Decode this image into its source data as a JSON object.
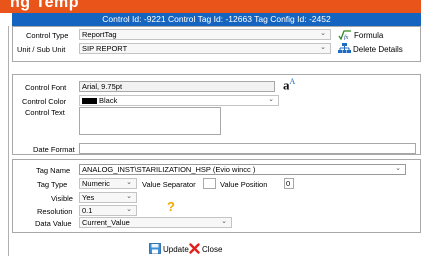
{
  "header": {
    "brand": "ng Temp",
    "title": "Control Id: -9221 Control Tag Id: -12663 Tag Config Id: -2452"
  },
  "control": {
    "type_label": "Control Type",
    "type_value": "ReportTag",
    "unit_label": "Unit / Sub Unit",
    "unit_value": "SIP REPORT",
    "formula_label": "Formula",
    "delete_label": "Delete Details"
  },
  "appearance": {
    "font_label": "Control Font",
    "font_value": "Arial, 9.75pt",
    "color_label": "Control Color",
    "color_value": "Black",
    "text_label": "Control Text",
    "text_value": "",
    "date_format_label": "Date Format",
    "date_format_value": ""
  },
  "tag": {
    "name_label": "Tag Name",
    "name_value": "ANALOG_INST\\STARILIZATION_HSP (Evio wincc )",
    "type_label": "Tag Type",
    "type_value": "Numeric",
    "separator_label": "Value Separator",
    "position_label": "Value Position",
    "position_value": "0",
    "visible_label": "Visible",
    "visible_value": "Yes",
    "resolution_label": "Resolution",
    "resolution_value": "0.1",
    "data_value_label": "Data Value",
    "data_value_value": "Current_Value"
  },
  "actions": {
    "update_label": "Update",
    "close_label": "Close"
  },
  "colors": {
    "brand": "#e8541a",
    "titlebar": "#1565c0"
  }
}
